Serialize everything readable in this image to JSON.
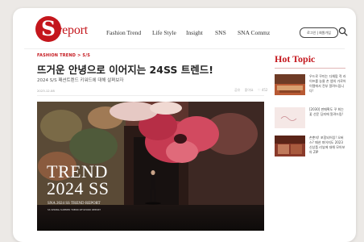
{
  "header": {
    "logo_letter": "S",
    "logo_text": "report",
    "nav": [
      {
        "label": "Fashion Trend"
      },
      {
        "label": "Life Style"
      },
      {
        "label": "Insight"
      },
      {
        "label": "SNS"
      },
      {
        "label": "SNA Commz"
      }
    ],
    "login_label": "로그인 | 회원가입"
  },
  "article": {
    "category": "FASHION TREND > S/S",
    "headline": "뜨거운 안녕으로 이어지는 24SS 트렌드!",
    "subtitle": "2024 S/S 패션트렌드 키워드에 대해 살펴보자",
    "date": "2023.12.08",
    "meta": [
      "공유",
      "좋아요",
      "♡ 452"
    ],
    "hero": {
      "title_line1": "TREND",
      "title_line2": "2024 SS",
      "caption": "SNA 2024 SS TREND REPORT",
      "caption_small": "SS SPRING SUMMER TREND KEYWORD REPORT"
    }
  },
  "hot_topic": {
    "title": "Hot Topic",
    "items": [
      {
        "text": "우드로 꾸미는 다채맘 적 라이프를 농물 손 앱의 가로어이템에서 전부 알려드립니다!"
      },
      {
        "text": "[2030] 판매확도 꾸 최는 꽃 선운 딩피에 알려드림!"
      },
      {
        "text": "손뿐지! 포함되어있! 오버스? 패션 피어지도 2023 신상품 리뷰에 대해 모아보아 ZIP"
      }
    ]
  },
  "colors": {
    "brand": "#c4161c",
    "background": "#ece9e6"
  }
}
